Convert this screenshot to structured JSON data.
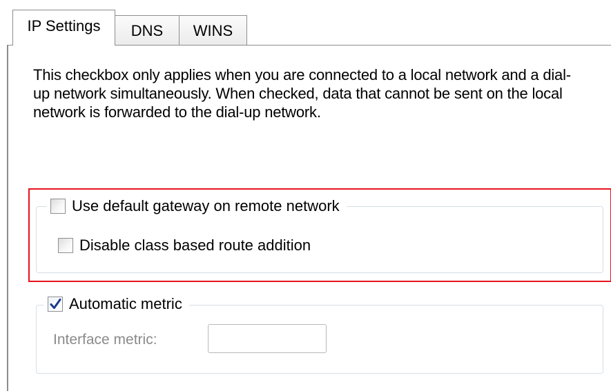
{
  "tabs": [
    {
      "label": "IP Settings",
      "active": true
    },
    {
      "label": "DNS",
      "active": false
    },
    {
      "label": "WINS",
      "active": false
    }
  ],
  "description": "This checkbox only applies when you are connected to a local network and a dial-up network simultaneously.  When checked, data that cannot be sent on the local network is forwarded to the dial-up network.",
  "gateway_group": {
    "default_gateway": {
      "label": "Use default gateway on remote network",
      "checked": false
    },
    "class_based_route": {
      "label": "Disable class based route addition",
      "checked": false
    }
  },
  "metric_group": {
    "automatic_metric": {
      "label": "Automatic metric",
      "checked": true
    },
    "interface_metric_label": "Interface metric:",
    "interface_metric_value": ""
  },
  "colors": {
    "highlight": "#e3141b",
    "disabled_text": "#8a8a8a",
    "checkmark": "#1c3a8a"
  },
  "icons": {
    "checkmark": "checkmark-icon"
  }
}
